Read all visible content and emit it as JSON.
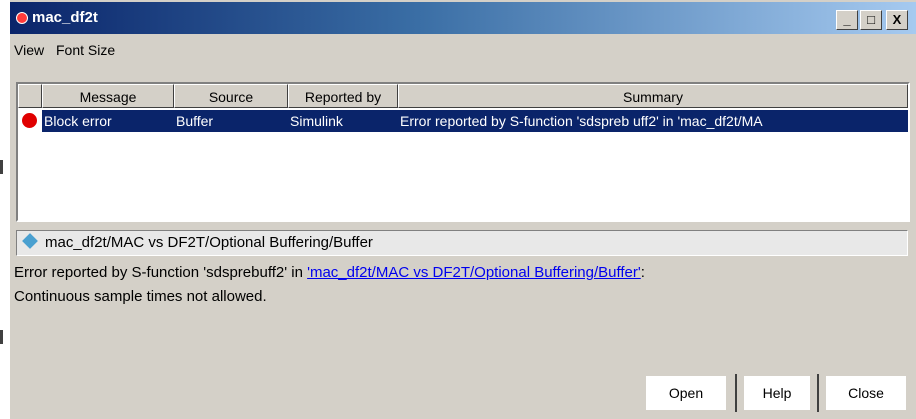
{
  "window": {
    "title": "mac_df2t",
    "min_label": "_",
    "max_label": "□",
    "close_label": "X"
  },
  "menu": [
    "View",
    "Font Size"
  ],
  "table": {
    "columns": [
      "Message",
      "Source",
      "Reported by",
      "Summary"
    ],
    "rows": [
      {
        "message": "Block error",
        "source": "Buffer",
        "reported_by": "Simulink",
        "summary": "Error reported by S-function 'sdspreb uff2' in 'mac_df2t/MA",
        "status": "error"
      }
    ]
  },
  "path": "mac_df2t/MAC vs DF2T/Optional Buffering/Buffer",
  "detail": {
    "prefix": "Error reported by S-function 'sdsprebuff2' in ",
    "link": "'mac_df2t/MAC vs DF2T/Optional Buffering/Buffer'",
    "suffix": ":",
    "line2": "Continuous sample times not allowed."
  },
  "buttons": {
    "open": "Open",
    "help": "Help",
    "close": "Close"
  }
}
